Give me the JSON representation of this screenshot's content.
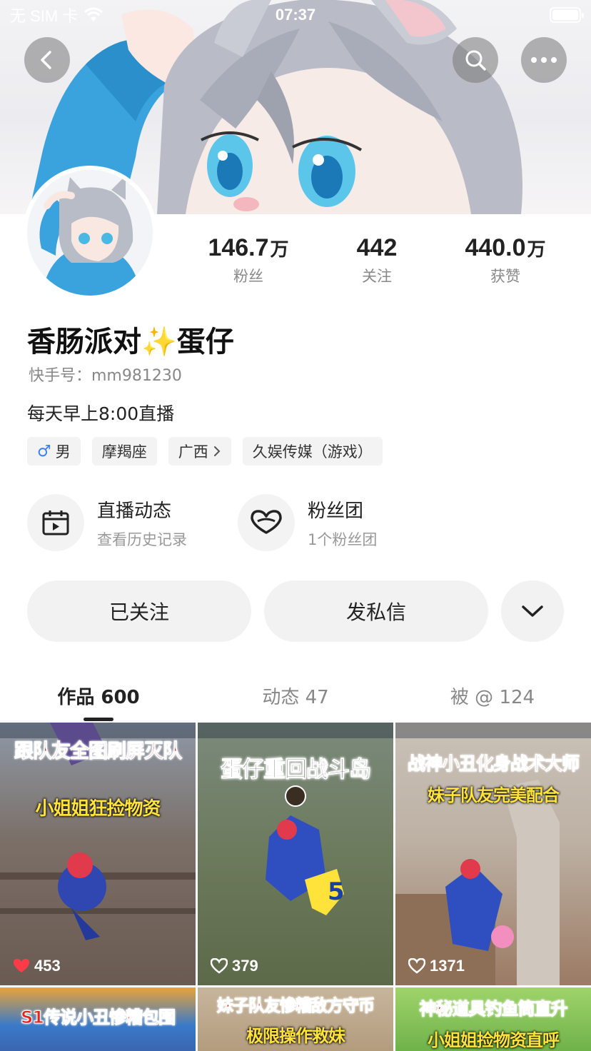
{
  "status_bar": {
    "carrier": "无 SIM 卡",
    "time": "07:37"
  },
  "profile": {
    "followers_num": "146.7",
    "followers_unit": "万",
    "followers_label": "粉丝",
    "following_num": "442",
    "following_label": "关注",
    "likes_num": "440.0",
    "likes_unit": "万",
    "likes_label": "获赞",
    "name": "香肠派对✨蛋仔",
    "kuaishou_id": "快手号：mm981230",
    "bio": "每天早上8:00直播",
    "tags": {
      "gender_symbol": "♂",
      "gender": "男",
      "zodiac": "摩羯座",
      "region": "广西",
      "org": "久娱传媒（游戏）"
    }
  },
  "features": {
    "live": {
      "title": "直播动态",
      "subtitle": "查看历史记录"
    },
    "fanclub": {
      "title": "粉丝团",
      "subtitle": "1个粉丝团"
    }
  },
  "actions": {
    "followed": "已关注",
    "message": "发私信"
  },
  "tabs": {
    "works": "作品 600",
    "moments": "动态 47",
    "mentioned": "被 @ 124"
  },
  "videos": [
    {
      "title": "跟队友全图刷屏灭队",
      "subtitle": "小姐姐狂捡物资",
      "likes": "453",
      "liked": true
    },
    {
      "title": "蛋仔重回战斗岛",
      "subtitle": "",
      "likes": "379",
      "liked": false
    },
    {
      "title": "战神小丑化身战术大师",
      "subtitle": "妹子队友完美配合",
      "likes": "1371",
      "liked": false
    },
    {
      "title": "S1传说小丑惨糟包围",
      "subtitle": "",
      "likes": "",
      "liked": false
    },
    {
      "title": "妹子队友惨糟敌方守币",
      "subtitle": "极限操作救妹",
      "likes": "",
      "liked": false
    },
    {
      "title": "神秘道具钓鱼筒直升",
      "subtitle": "小姐姐捡物资直呼",
      "likes": "",
      "liked": false
    }
  ],
  "colors": {
    "accent_blue": "#3d7ff2",
    "like_red": "#ff3b47",
    "caption_red": "#e3261b",
    "caption_yellow": "#ffe23a"
  }
}
